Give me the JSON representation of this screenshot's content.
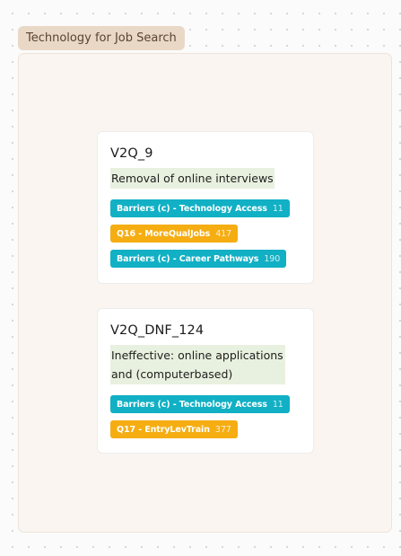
{
  "group": {
    "title": "Technology for Job Search"
  },
  "colors": {
    "barrier_tag": "#11b0c4",
    "question_tag": "#f5ad12",
    "quote_highlight": "#e8f1df",
    "group_label_bg": "#ead8c6"
  },
  "cards": [
    {
      "id": "V2Q_9",
      "quote": "Removal of online interviews",
      "tags": [
        {
          "label": "Barriers (c) - Technology Access",
          "count": "11",
          "kind": "barrier"
        },
        {
          "label": "Q16 - MoreQualJobs",
          "count": "417",
          "kind": "question"
        },
        {
          "label": "Barriers (c) - Career Pathways",
          "count": "190",
          "kind": "barrier"
        }
      ]
    },
    {
      "id": "V2Q_DNF_124",
      "quote": "Ineffective: online applications and (computerbased)",
      "tags": [
        {
          "label": "Barriers (c) - Technology Access",
          "count": "11",
          "kind": "barrier"
        },
        {
          "label": "Q17 - EntryLevTrain",
          "count": "377",
          "kind": "question"
        }
      ]
    }
  ]
}
